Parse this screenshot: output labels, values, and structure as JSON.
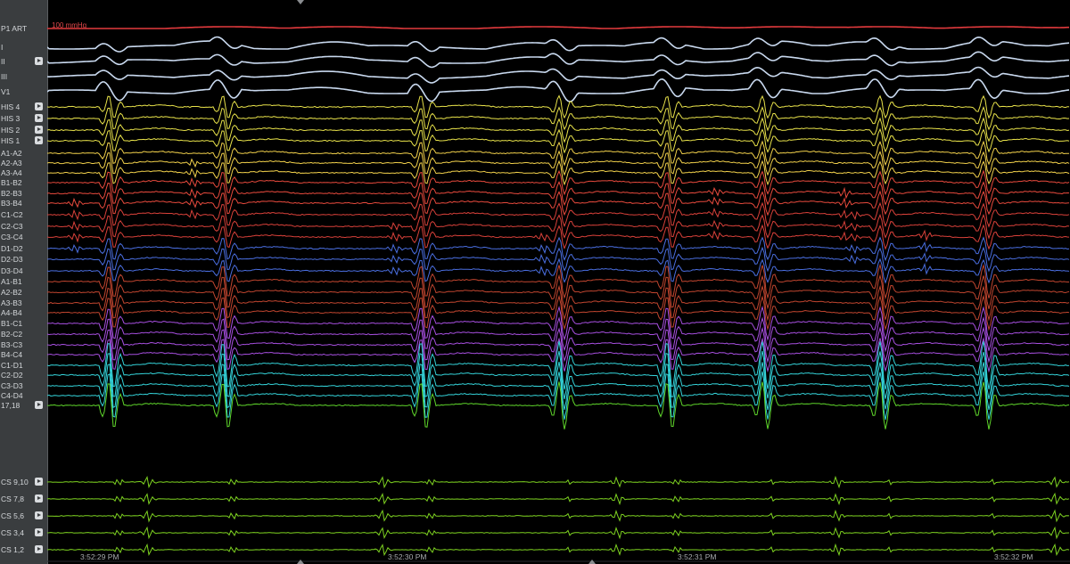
{
  "art_scale": "100 mmHg",
  "colors": {
    "art": "#e23a3d",
    "surface": "#c9d9ef",
    "his": "#e8e24a",
    "a": "#f2d14b",
    "b": "#e84a3d",
    "c": "#d9413a",
    "d": "#4a6ee0",
    "a2": "#c0452f",
    "b_mid": "#8f4ad9",
    "c_mid": "#a74fe0",
    "cyan": "#34d3d9",
    "green": "#5fd62b",
    "cs": "#7ed321"
  },
  "channels": [
    {
      "label": "P1 ART",
      "button": false
    },
    {
      "label": "I",
      "button": false
    },
    {
      "label": "II",
      "button": true
    },
    {
      "label": "III",
      "button": false
    },
    {
      "label": "V1",
      "button": false
    },
    {
      "label": "HIS 4",
      "button": true
    },
    {
      "label": "HIS 3",
      "button": true
    },
    {
      "label": "HIS 2",
      "button": true
    },
    {
      "label": "HIS 1",
      "button": true
    },
    {
      "label": "A1-A2",
      "button": false
    },
    {
      "label": "A2-A3",
      "button": false
    },
    {
      "label": "A3-A4",
      "button": false
    },
    {
      "label": "B1-B2",
      "button": false
    },
    {
      "label": "B2-B3",
      "button": false
    },
    {
      "label": "B3-B4",
      "button": false
    },
    {
      "label": "C1-C2",
      "button": false
    },
    {
      "label": "C2-C3",
      "button": false
    },
    {
      "label": "C3-C4",
      "button": false
    },
    {
      "label": "D1-D2",
      "button": false
    },
    {
      "label": "D2-D3",
      "button": false
    },
    {
      "label": "D3-D4",
      "button": false
    },
    {
      "label": "A1-B1",
      "button": false
    },
    {
      "label": "A2-B2",
      "button": false
    },
    {
      "label": "A3-B3",
      "button": false
    },
    {
      "label": "A4-B4",
      "button": false
    },
    {
      "label": "B1-C1",
      "button": false
    },
    {
      "label": "B2-C2",
      "button": false
    },
    {
      "label": "B3-C3",
      "button": false
    },
    {
      "label": "B4-C4",
      "button": false
    },
    {
      "label": "C1-D1",
      "button": false
    },
    {
      "label": "C2-D2",
      "button": false
    },
    {
      "label": "C3-D3",
      "button": false
    },
    {
      "label": "C4-D4",
      "button": false
    },
    {
      "label": "17,18",
      "button": true
    },
    {
      "label": "CS 9,10",
      "button": true
    },
    {
      "label": "CS 7,8",
      "button": true
    },
    {
      "label": "CS 5,6",
      "button": true
    },
    {
      "label": "CS 3,4",
      "button": true
    },
    {
      "label": "CS 1,2",
      "button": true
    }
  ],
  "time_labels": [
    "3:52:29 PM",
    "3:52:30 PM",
    "3:52:31 PM",
    "3:52:32 PM"
  ]
}
